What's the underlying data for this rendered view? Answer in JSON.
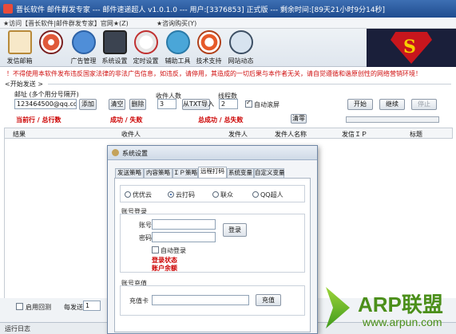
{
  "window": {
    "title": "晋长软件 邮件群发专家 --- 邮件速递超人 v1.0.1.0 --- 用户:[3376853] 正式版 --- 剩余时间:[89天21小时9分14秒]"
  },
  "menu": [
    "★访问【晋长软件|邮件群发专家】官网★(Z)",
    "★咨询购买(Y)"
  ],
  "toolbar": [
    {
      "label": "发信邮箱",
      "icon": "mail-sender-icon"
    },
    {
      "label": "",
      "icon": "record-icon"
    },
    {
      "label": "广告管理",
      "icon": "envelope-icon"
    },
    {
      "label": "系统设置",
      "icon": "sliders-icon"
    },
    {
      "label": "定时设置",
      "icon": "clock-icon"
    },
    {
      "label": "辅助工具",
      "icon": "tools-icon"
    },
    {
      "label": "技术支持",
      "icon": "lifebuoy-icon"
    },
    {
      "label": "网站动态",
      "icon": "globe-icon"
    }
  ],
  "banner": {
    "letter": "S"
  },
  "warning": "！不得使用本软件发布违反国家法律的非法广告信息，如违反，请停用，其造成的一切后果与本作者无关，请自觉遵循和谐原创性的网络营销环境！",
  "send": {
    "section": "<开始发送 >",
    "mailbox_label": "邮址 (多个用分号隔开)",
    "mailbox_value": "123464500@qq.com",
    "add": "添加",
    "clear": "清空",
    "delete": "删除",
    "recipients_label": "收件人数",
    "recipients_value": "3",
    "import": "从TXT导入",
    "threads_label": "线程数",
    "threads_value": "2",
    "auto_scroll": "自动滚屏",
    "start": "开始",
    "continue": "继续",
    "stop": "停止",
    "current_total": "当前行 / 总行数",
    "success_fail": "成功 / 失败",
    "total_success_fail": "总成功 / 总失败",
    "clear_zero": "清零"
  },
  "table": {
    "columns": [
      "结果",
      "收件人",
      "发件人",
      "发件人名称",
      "发信ＩＰ",
      "标题"
    ]
  },
  "bottom": {
    "enable_reply": "启用回测",
    "per_send": "每发送",
    "per_send_value": "1"
  },
  "status": {
    "log": "运行日志"
  },
  "dialog": {
    "title": "系统设置",
    "tabs": [
      "发送策略",
      "内容策略",
      "ＩＰ策略",
      "远程打码",
      "系统变量",
      "自定义变量"
    ],
    "services": [
      "优优云",
      "云打码",
      "联众",
      "QQ超人"
    ],
    "account_group": "账号登录",
    "account_label": "账号",
    "password_label": "密码",
    "login": "登录",
    "auto_login": "自动登录",
    "login_status": "登录状态",
    "balance": "账户余额",
    "recharge_group": "账号充值",
    "card_label": "充值卡",
    "recharge": "充值"
  },
  "watermark": {
    "title": "ARP联盟",
    "url": "www.arpun.com"
  }
}
